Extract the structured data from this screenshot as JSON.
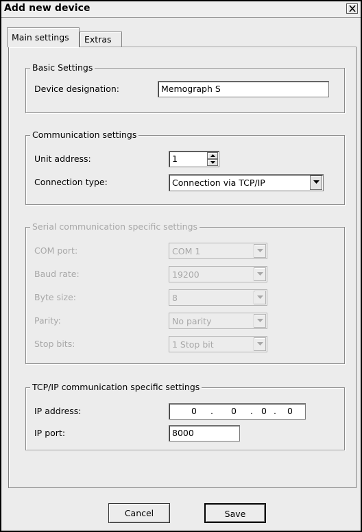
{
  "window": {
    "title": "Add new device",
    "close_icon": "close-x-icon"
  },
  "tabs": [
    {
      "label": "Main settings",
      "active": true
    },
    {
      "label": "Extras",
      "active": false
    }
  ],
  "basic_settings": {
    "legend": "Basic Settings",
    "device_designation_label": "Device designation:",
    "device_designation_value": "Memograph S"
  },
  "communication": {
    "legend": "Communication settings",
    "unit_address_label": "Unit address:",
    "unit_address_value": "1",
    "connection_type_label": "Connection type:",
    "connection_type_value": "Connection via TCP/IP"
  },
  "serial": {
    "legend": "Serial communication specific settings",
    "com_port_label": "COM port:",
    "com_port_value": "COM 1",
    "baud_rate_label": "Baud rate:",
    "baud_rate_value": "19200",
    "byte_size_label": "Byte size:",
    "byte_size_value": "8",
    "parity_label": "Parity:",
    "parity_value": "No parity",
    "stop_bits_label": "Stop bits:",
    "stop_bits_value": "1 Stop bit"
  },
  "tcpip": {
    "legend": "TCP/IP communication specific settings",
    "ip_address_label": "IP address:",
    "ip_octets": [
      "0",
      "0",
      "0",
      "0"
    ],
    "ip_separator": ".",
    "ip_port_label": "IP port:",
    "ip_port_value": "8000"
  },
  "buttons": {
    "cancel": "Cancel",
    "save": "Save"
  }
}
